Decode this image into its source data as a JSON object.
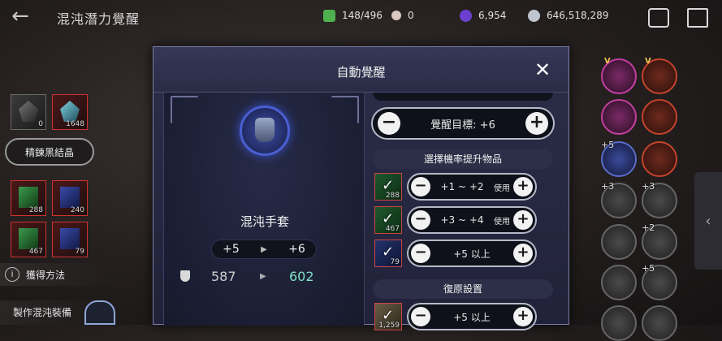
{
  "header": {
    "title": "混沌潛力覺醒",
    "resources": [
      {
        "icon": "green-gem-icon",
        "value": "148/496",
        "color": "#4fb04f"
      },
      {
        "icon": "pearl-icon",
        "value": "0",
        "color": "#d9c8c0"
      },
      {
        "icon": "purple-orb-icon",
        "value": "6,954",
        "color": "#6b3fd0"
      },
      {
        "icon": "silver-coin-icon",
        "value": "646,518,289",
        "color": "#bfc6d0"
      }
    ]
  },
  "left": {
    "materials_top": [
      {
        "count": "0"
      },
      {
        "count": "1648"
      }
    ],
    "refine_button": "精鍊黑結晶",
    "scrolls": [
      {
        "count": "288"
      },
      {
        "count": "240"
      },
      {
        "count": "467"
      },
      {
        "count": "79"
      }
    ],
    "how_to": "獲得方法",
    "craft": "製作混沌裝備"
  },
  "modal": {
    "title": "自動覺醒",
    "item_name": "混沌手套",
    "level_from": "+5",
    "level_to": "+6",
    "stat_from": "587",
    "stat_to": "602",
    "target_label": "覺醒目標:",
    "target_value": "+6",
    "section_items": "選擇機率提升物品",
    "options": [
      {
        "count": "288",
        "from": "+1",
        "to": "+2",
        "sep": "~",
        "action": "使用",
        "style": "green"
      },
      {
        "count": "467",
        "from": "+3",
        "to": "+4",
        "sep": "~",
        "action": "使用",
        "style": "green"
      },
      {
        "count": "79",
        "from": "+5",
        "to": "",
        "sep": "以上",
        "action": "",
        "style": "blue"
      }
    ],
    "section_restore": "復原設置",
    "restore_option": {
      "count": "1,259",
      "from": "+5",
      "sep": "以上"
    }
  },
  "right_grid": [
    {
      "level": "",
      "style": "pink",
      "v": "V"
    },
    {
      "level": "",
      "style": "red",
      "v": "V"
    },
    {
      "level": "",
      "style": "pink",
      "v": ""
    },
    {
      "level": "",
      "style": "red",
      "v": ""
    },
    {
      "level": "+5",
      "style": "blue",
      "v": ""
    },
    {
      "level": "",
      "style": "red",
      "v": ""
    },
    {
      "level": "+3",
      "style": "gray",
      "v": ""
    },
    {
      "level": "+3",
      "style": "gray",
      "v": ""
    },
    {
      "level": "",
      "style": "gray",
      "v": ""
    },
    {
      "level": "+2",
      "style": "gray",
      "v": ""
    },
    {
      "level": "",
      "style": "gray",
      "v": ""
    },
    {
      "level": "+5",
      "style": "gray",
      "v": ""
    },
    {
      "level": "",
      "style": "gray",
      "v": ""
    },
    {
      "level": "",
      "style": "gray",
      "v": ""
    }
  ]
}
